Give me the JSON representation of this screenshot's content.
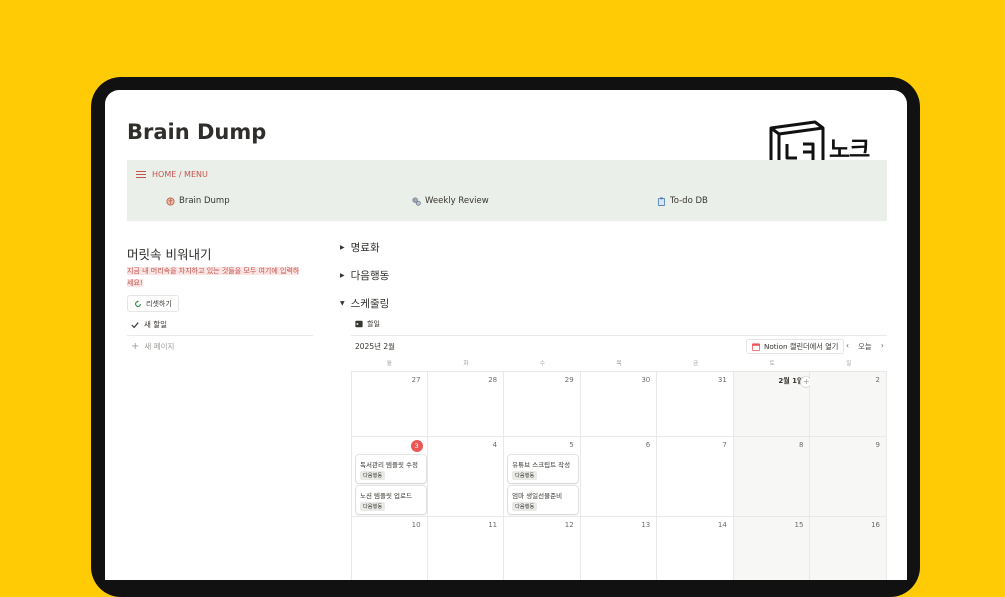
{
  "page": {
    "title": "Brain Dump"
  },
  "logo": {
    "text": "노크",
    "box_glyph": "ㄴㅋ"
  },
  "menu": {
    "header": "HOME / MENU",
    "items": [
      {
        "label": "Brain Dump",
        "icon": "brain-icon"
      },
      {
        "label": "Weekly Review",
        "icon": "gears-icon"
      },
      {
        "label": "To-do DB",
        "icon": "clipboard-icon"
      }
    ]
  },
  "left": {
    "title": "머릿속 비워내기",
    "note": "지금 내 머리속을 차지하고 있는 것들을 모두 여기에 입력하세요!",
    "reset_label": "리셋하기",
    "new_todo": "새 할일",
    "new_page": "새 페이지"
  },
  "right": {
    "toggles": [
      "명료화",
      "다음행동",
      "스케줄링"
    ],
    "tab_label": "할일",
    "month": "2025년 2월",
    "open_calendar": "Notion 캘린더에서 열기",
    "today": "오늘",
    "weekdays": [
      "월",
      "화",
      "수",
      "목",
      "금",
      "토",
      "일"
    ],
    "weeks": [
      [
        "27",
        "28",
        "29",
        "30",
        "31",
        "2월 1일",
        "2"
      ],
      [
        "3",
        "4",
        "5",
        "6",
        "7",
        "8",
        "9"
      ],
      [
        "10",
        "11",
        "12",
        "13",
        "14",
        "15",
        "16"
      ]
    ],
    "today_date": "3",
    "events": [
      {
        "day": "3",
        "order": 0,
        "title": "독서관리 템플릿 수정",
        "tag": "다음행동"
      },
      {
        "day": "3",
        "order": 1,
        "title": "노션 템플릿 업로드",
        "tag": "다음행동"
      },
      {
        "day": "5",
        "order": 0,
        "title": "유튜브 스크립트 작성",
        "tag": "다음행동"
      },
      {
        "day": "5",
        "order": 1,
        "title": "엄마 생일선물준비",
        "tag": "다음행동"
      }
    ]
  },
  "colors": {
    "background": "#FFCB05",
    "accent_red": "#c4554d",
    "today_badge": "#eb5757",
    "menu_bg": "#ebefea"
  }
}
